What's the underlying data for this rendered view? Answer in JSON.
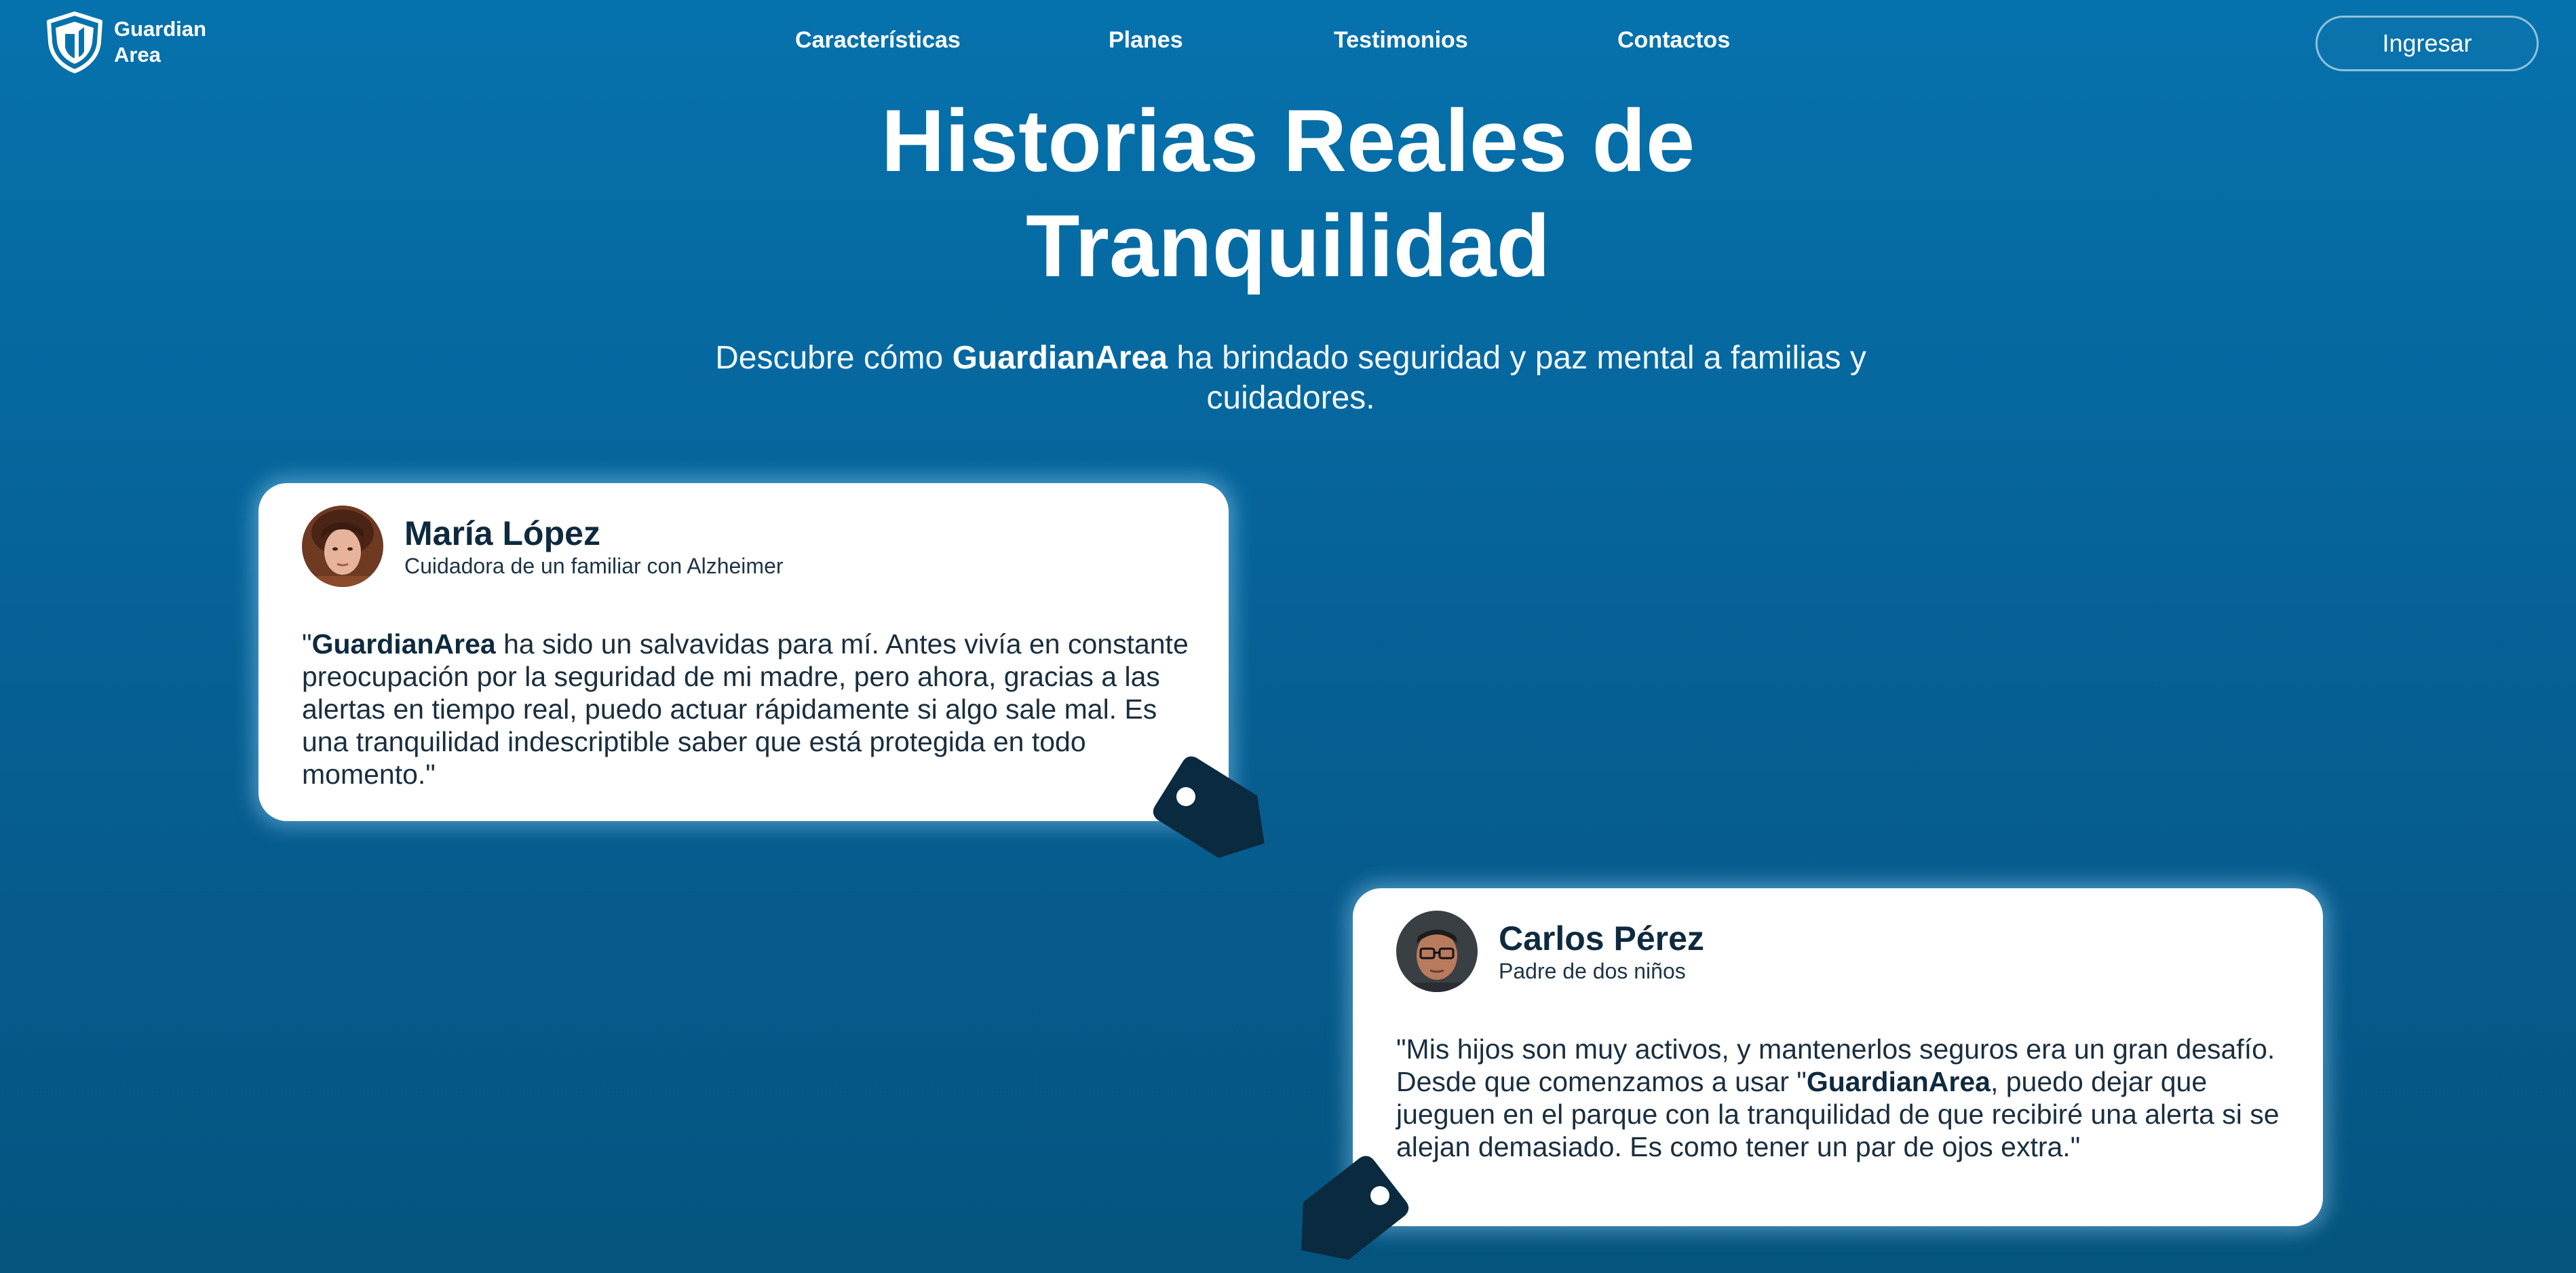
{
  "brand": {
    "line1": "Guardian",
    "line2": "Area"
  },
  "nav": {
    "links": [
      "Características",
      "Planes",
      "Testimonios",
      "Contactos"
    ],
    "login_label": "Ingresar"
  },
  "hero": {
    "title_line1": "Historias Reales de",
    "title_line2": "Tranquilidad",
    "subtitle_pre": "Descubre cómo ",
    "subtitle_brand": "GuardianArea",
    "subtitle_post": " ha brindado seguridad y paz mental a familias y cuidadores."
  },
  "testimonials": [
    {
      "name": "María López",
      "role": "Cuidadora de un familiar con Alzheimer",
      "quote_pre": "\"",
      "quote_brand": "GuardianArea",
      "quote_post": " ha sido un salvavidas para mí. Antes vivía en constante preocupación por la seguridad de mi madre, pero ahora, gracias a las alertas en tiempo real, puedo actuar rápidamente si algo sale mal. Es una tranquilidad indescriptible saber que está protegida en todo momento.\""
    },
    {
      "name": "Carlos Pérez",
      "role": "Padre de dos niños",
      "quote_pre": "\"Mis hijos son muy activos, y mantenerlos seguros era un gran desafío. Desde que comenzamos a usar \"",
      "quote_brand": "GuardianArea",
      "quote_post": ", puedo dejar que jueguen en el parque con la tranquilidad de que recibiré una alerta si se alejan demasiado. Es como tener un par de ojos extra.\""
    }
  ],
  "colors": {
    "background_top": "#0672ad",
    "background_bottom": "#05547f",
    "card": "#ffffff",
    "text_dark": "#0e2a3f",
    "tag": "#0a2a40"
  },
  "icons": {
    "logo": "shield-icon",
    "decoration": "tag-icon"
  }
}
